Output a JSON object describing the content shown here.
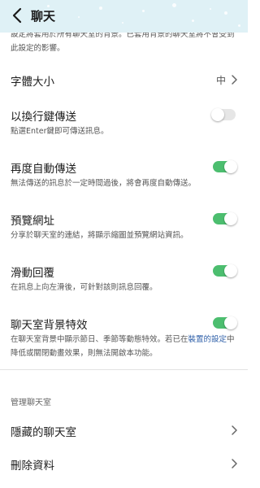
{
  "header": {
    "title": "聊天",
    "back_icon": "chevron-left-icon",
    "background_color": "#dff1f6"
  },
  "top_description": "設定將套用於所有聊天室的背景。已套用背景的聊天室將不會受到此設定的影響。",
  "font_size": {
    "title": "字體大小",
    "value": "中"
  },
  "settings": [
    {
      "key": "enter_send",
      "title": "以換行鍵傳送",
      "desc": "點選Enter鍵即可傳送訊息。",
      "enabled": false
    },
    {
      "key": "auto_resend",
      "title": "再度自動傳送",
      "desc": "無法傳送的訊息於一定時間過後，將會再度自動傳送。",
      "enabled": true
    },
    {
      "key": "url_preview",
      "title": "預覽網址",
      "desc": "分享於聊天室的連結，將顯示縮圖並預覽網站資訊。",
      "enabled": true
    },
    {
      "key": "swipe_reply",
      "title": "滑動回覆",
      "desc": "在訊息上向左滑後，可針對該則訊息回覆。",
      "enabled": true
    }
  ],
  "background_effects": {
    "title": "聊天室背景特效",
    "desc_before": "在聊天室背景中顯示節日、季節等動態特效。若已在",
    "desc_link": "裝置的設定",
    "desc_after": "中降低或關閉動畫效果，則無法開啟本功能。",
    "enabled": true
  },
  "manage_section": {
    "header": "管理聊天室",
    "items": [
      "隱藏的聊天室",
      "刪除資料"
    ]
  },
  "colors": {
    "toggle_on": "#4cbe6f",
    "toggle_off": "#e6e6e6",
    "link": "#2e5fa8"
  }
}
